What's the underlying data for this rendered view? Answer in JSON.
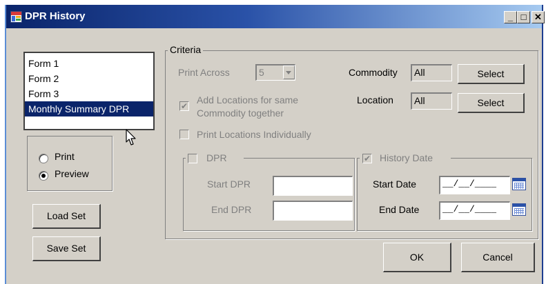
{
  "window": {
    "title": "DPR History",
    "controls": {
      "minimize": "_",
      "maximize": "□",
      "close": "✕"
    }
  },
  "forms_list": {
    "items": [
      "Form 1",
      "Form 2",
      "Form 3",
      "Monthly Summary DPR"
    ],
    "selected_index": 3
  },
  "output_mode": {
    "options": [
      "Print",
      "Preview"
    ],
    "selected": "Preview"
  },
  "buttons": {
    "load_set": "Load Set",
    "save_set": "Save Set",
    "ok": "OK",
    "cancel": "Cancel"
  },
  "criteria": {
    "legend": "Criteria",
    "print_across_label": "Print Across",
    "print_across_value": "5",
    "commodity_label": "Commodity",
    "commodity_value": "All",
    "commodity_select": "Select",
    "location_label": "Location",
    "location_value": "All",
    "location_select": "Select",
    "add_locations_line1": "Add Locations for same",
    "add_locations_line2": "Commodity together",
    "add_locations_checked": true,
    "print_individually": "Print Locations Individually",
    "print_individually_checked": false,
    "dpr": {
      "legend": "DPR",
      "checked": false,
      "start_label": "Start DPR",
      "start_value": "",
      "end_label": "End DPR",
      "end_value": ""
    },
    "history_date": {
      "legend": "History Date",
      "checked": true,
      "start_label": "Start Date",
      "start_value": "__/__/____",
      "end_label": "End Date",
      "end_value": "__/__/____"
    }
  },
  "icons": {
    "app": "report-icon",
    "calendar": "calendar-icon",
    "chevron": "chevron-down-icon",
    "check": "✔"
  },
  "colors": {
    "titlebar_start": "#0a246a",
    "titlebar_end": "#a6caf0",
    "selection": "#0a246a",
    "face": "#d4d0c8",
    "disabled_text": "#808080"
  }
}
